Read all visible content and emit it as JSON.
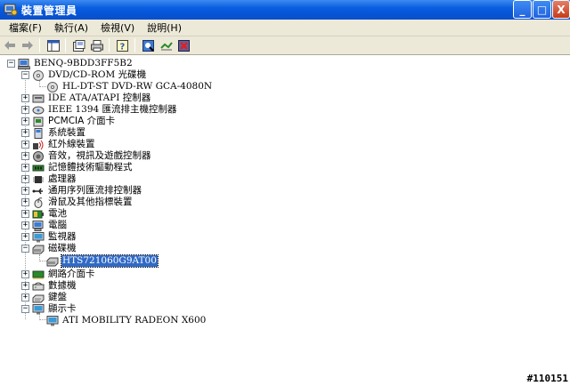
{
  "window": {
    "title": "裝置管理員",
    "controls": {
      "minimize": "_",
      "maximize": "□",
      "close": "X"
    }
  },
  "menu": [
    "檔案(F)",
    "執行(A)",
    "檢視(V)",
    "說明(H)"
  ],
  "toolbar": {
    "icons": [
      "back-arrow-icon",
      "forward-arrow-icon",
      "show-hide-tree-icon",
      "properties-icon",
      "print-icon",
      "help-icon",
      "scan-hardware-icon",
      "update-driver-icon",
      "uninstall-icon"
    ]
  },
  "tree": {
    "root": "BENQ-9BDD3FF5B2",
    "categories": [
      {
        "label": "DVD/CD-ROM 光碟機",
        "expanded": true,
        "children": [
          "HL-DT-ST DVD-RW GCA-4080N"
        ]
      },
      {
        "label": "IDE ATA/ATAPI 控制器",
        "expanded": false
      },
      {
        "label": "IEEE 1394 匯流排主機控制器",
        "expanded": false
      },
      {
        "label": "PCMCIA 介面卡",
        "expanded": false
      },
      {
        "label": "系統裝置",
        "expanded": false
      },
      {
        "label": "紅外線裝置",
        "expanded": false
      },
      {
        "label": "音效，視訊及遊戲控制器",
        "expanded": false
      },
      {
        "label": "記憶體技術驅動程式",
        "expanded": false
      },
      {
        "label": "處理器",
        "expanded": false
      },
      {
        "label": "通用序列匯流排控制器",
        "expanded": false
      },
      {
        "label": "滑鼠及其他指標裝置",
        "expanded": false
      },
      {
        "label": "電池",
        "expanded": false
      },
      {
        "label": "電腦",
        "expanded": false
      },
      {
        "label": "監視器",
        "expanded": false
      },
      {
        "label": "磁碟機",
        "expanded": true,
        "children": [
          "HTS721060G9AT00"
        ]
      },
      {
        "label": "網路介面卡",
        "expanded": false
      },
      {
        "label": "數據機",
        "expanded": false
      },
      {
        "label": "鍵盤",
        "expanded": false
      },
      {
        "label": "顯示卡",
        "expanded": true,
        "children": [
          "ATI MOBILITY RADEON X600"
        ]
      }
    ],
    "selected": "HTS721060G9AT00"
  },
  "watermark": "#110151"
}
